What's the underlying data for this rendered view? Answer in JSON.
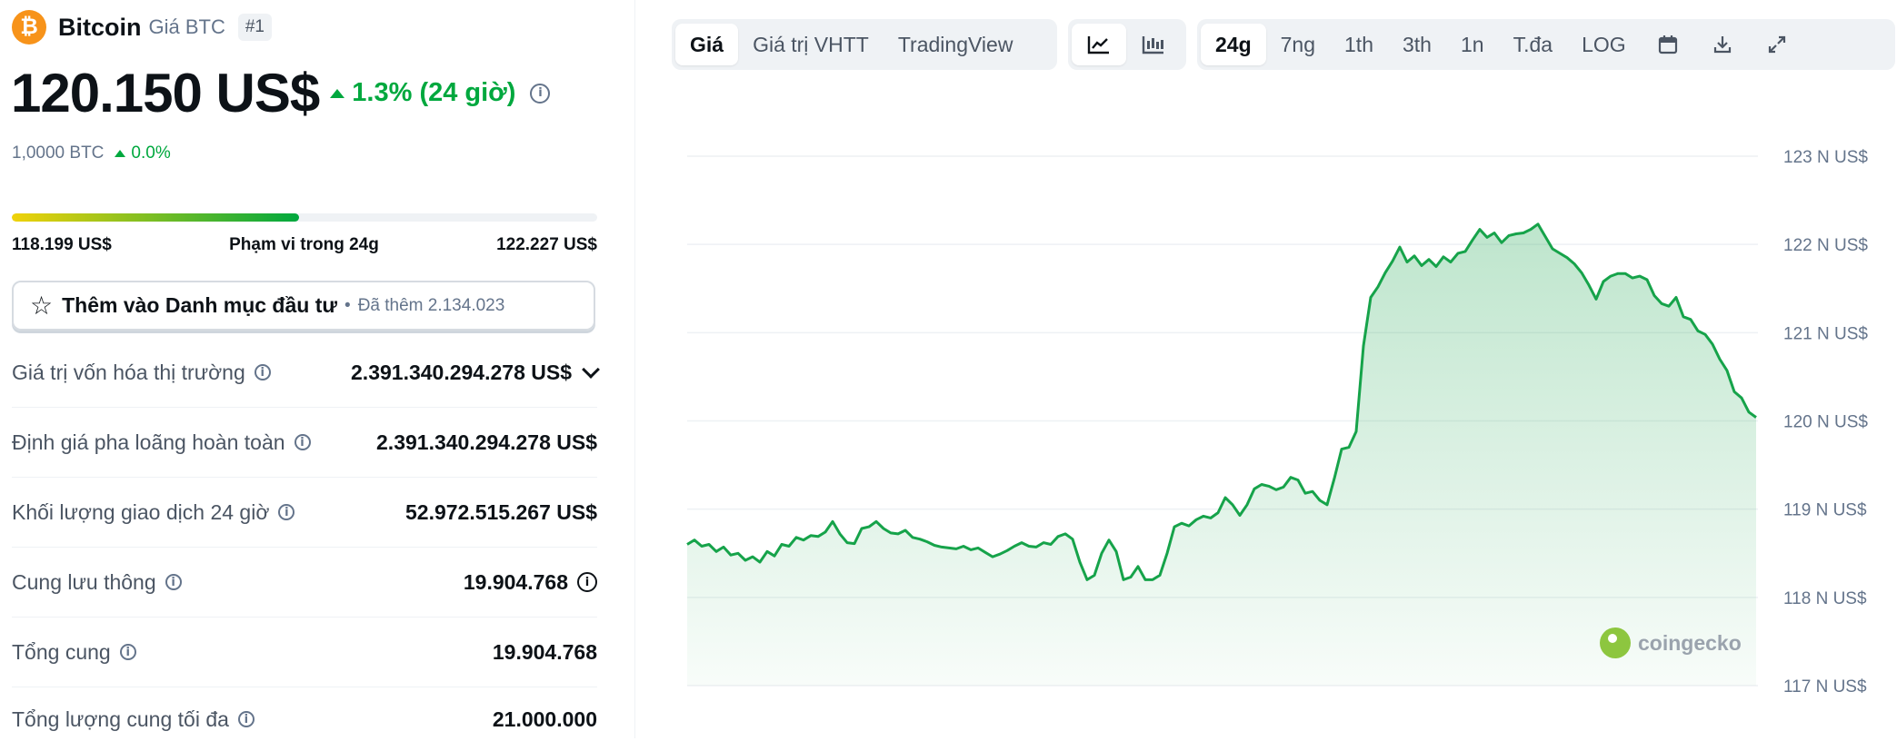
{
  "coin": {
    "logo_glyph": "₿",
    "name": "Bitcoin",
    "subtitle": "Giá BTC",
    "rank": "#1",
    "price": "120.150 US$",
    "change_24h": "1.3% (24 giờ)",
    "btc_amount": "1,0000 BTC",
    "btc_change": "0.0%",
    "info_glyph": "i"
  },
  "range": {
    "low": "118.199 US$",
    "label": "Phạm vi trong 24g",
    "high": "122.227 US$",
    "fill_fraction": 0.49
  },
  "watchlist": {
    "star_glyph": "☆",
    "label": "Thêm vào Danh mục đầu tư",
    "separator": "•",
    "added_text": "Đã thêm 2.134.023"
  },
  "stats": [
    {
      "label": "Giá trị vốn hóa thị trường",
      "value": "2.391.340.294.278 US$"
    },
    {
      "label": "Định giá pha loãng hoàn toàn",
      "value": "2.391.340.294.278 US$"
    },
    {
      "label": "Khối lượng giao dịch 24 giờ",
      "value": "52.972.515.267 US$"
    },
    {
      "label": "Cung lưu thông",
      "value": "19.904.768"
    },
    {
      "label": "Tổng cung",
      "value": "19.904.768"
    },
    {
      "label": "Tổng lượng cung tối đa",
      "value": "21.000.000"
    }
  ],
  "toolbar": {
    "view_tabs": [
      "Giá",
      "Giá trị VHTT",
      "TradingView"
    ],
    "active_view": "Giá",
    "chart_types": [
      "line-chart-icon",
      "candlestick-chart-icon"
    ],
    "ranges": [
      "24g",
      "7ng",
      "1th",
      "3th",
      "1n",
      "T.đa",
      "LOG"
    ],
    "active_range": "24g",
    "tools": [
      "calendar-icon",
      "download-icon",
      "expand-icon"
    ]
  },
  "chart_data": {
    "type": "area",
    "y_tick_labels": [
      "123 N US$",
      "122 N US$",
      "121 N US$",
      "120 N US$",
      "119 N US$",
      "118 N US$",
      "117 N US$"
    ],
    "ylim": [
      117000,
      123000
    ],
    "y_ticks": [
      123000,
      122000,
      121000,
      120000,
      119000,
      118000,
      117000
    ],
    "grid": true,
    "line_color": "#16a34a",
    "fill_color": "#16a34a",
    "watermark": "coingecko",
    "values": [
      118600,
      118650,
      118580,
      118600,
      118520,
      118570,
      118480,
      118500,
      118420,
      118460,
      118400,
      118520,
      118470,
      118600,
      118580,
      118680,
      118650,
      118700,
      118690,
      118740,
      118860,
      118720,
      118620,
      118610,
      118780,
      118800,
      118860,
      118780,
      118730,
      118720,
      118760,
      118680,
      118660,
      118630,
      118590,
      118570,
      118560,
      118550,
      118580,
      118540,
      118560,
      118510,
      118460,
      118490,
      118530,
      118580,
      118620,
      118580,
      118570,
      118620,
      118600,
      118690,
      118720,
      118660,
      118400,
      118200,
      118250,
      118500,
      118650,
      118520,
      118200,
      118230,
      118350,
      118200,
      118200,
      118250,
      118500,
      118800,
      118840,
      118810,
      118880,
      118920,
      118900,
      118960,
      119130,
      119050,
      118930,
      119050,
      119230,
      119280,
      119260,
      119220,
      119250,
      119360,
      119330,
      119180,
      119200,
      119100,
      119050,
      119350,
      119680,
      119700,
      119880,
      120850,
      121400,
      121520,
      121680,
      121810,
      121970,
      121800,
      121870,
      121760,
      121830,
      121750,
      121860,
      121800,
      121900,
      121920,
      122050,
      122170,
      122080,
      122130,
      122020,
      122100,
      122120,
      122130,
      122170,
      122230,
      122090,
      121950,
      121900,
      121850,
      121780,
      121680,
      121540,
      121380,
      121580,
      121640,
      121670,
      121670,
      121620,
      121640,
      121600,
      121420,
      121330,
      121300,
      121400,
      121180,
      121150,
      121020,
      120980,
      120870,
      120700,
      120570,
      120330,
      120260,
      120100,
      120040
    ]
  }
}
